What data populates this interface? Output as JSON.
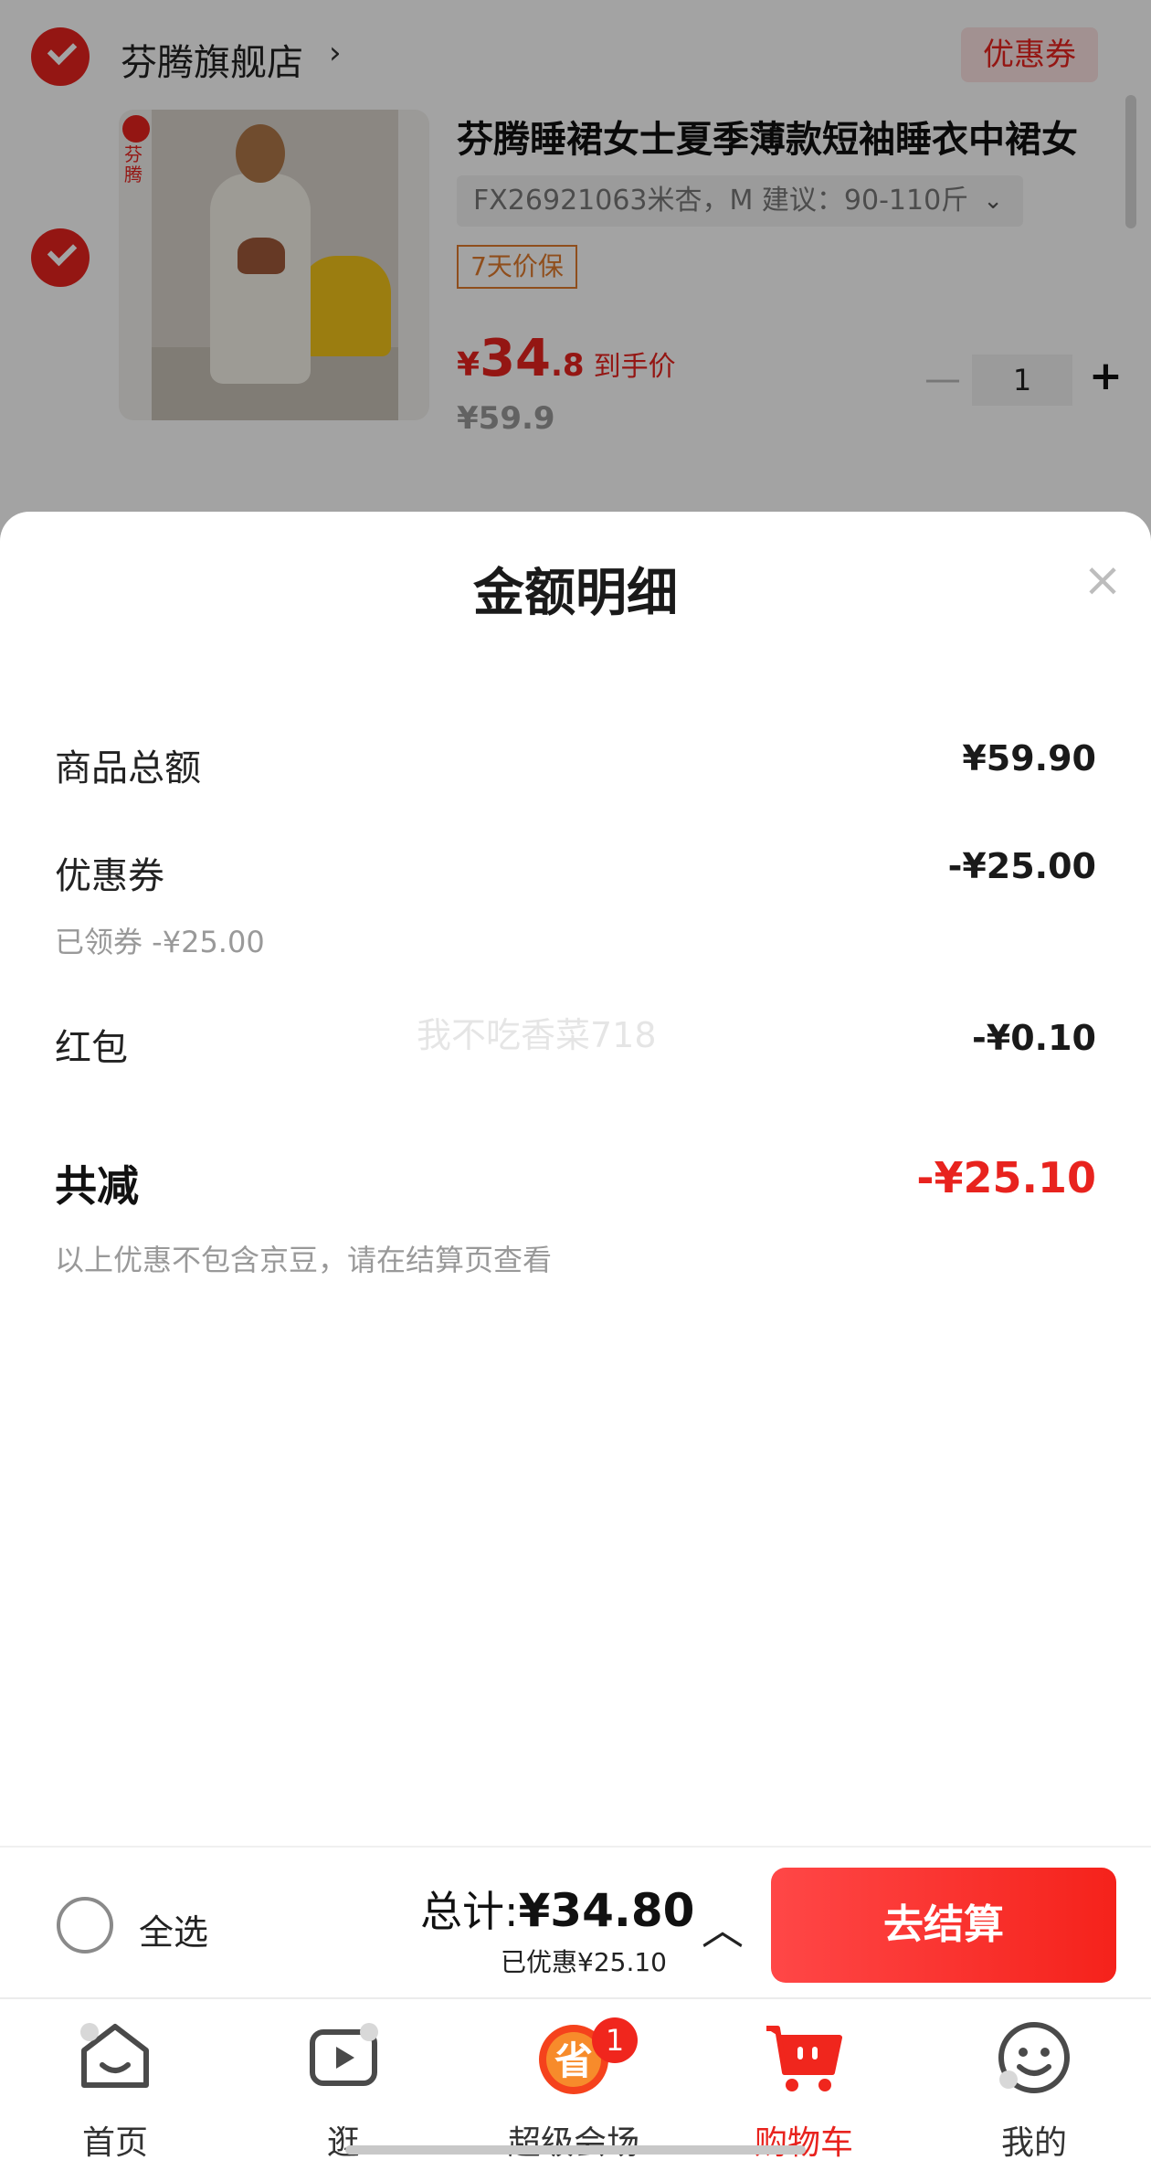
{
  "store": {
    "name": "芬腾旗舰店",
    "arrow": "›",
    "coupon_tag": "优惠券"
  },
  "product": {
    "title": "芬腾睡裙女士夏季薄款短袖睡衣中裙女",
    "sku": "FX26921063米杏，M 建议：90-110斤",
    "sku_chevron": "⌄",
    "badge": "7天价保",
    "price_yen": "¥",
    "price_int": "34",
    "price_dec": ".8",
    "price_label": "到手价",
    "original_price": "¥59.9",
    "quantity": "1",
    "minus": "—",
    "plus": "+",
    "logo_text": "芬腾"
  },
  "sheet": {
    "title": "金额明细",
    "close": "×",
    "rows": [
      {
        "label": "商品总额",
        "amount": "¥59.90"
      },
      {
        "label": "优惠券",
        "amount": "-¥25.00",
        "sub": "已领券 -¥25.00"
      },
      {
        "label": "红包",
        "amount": "-¥0.10"
      }
    ],
    "total_label": "共减",
    "total_amount": "-¥25.10",
    "note": "以上优惠不包含京豆，请在结算页查看",
    "watermark": "我不吃香菜718"
  },
  "checkout": {
    "select_all": "全选",
    "total_prefix": "总计:",
    "total_value": "¥34.80",
    "saved": "已优惠¥25.10",
    "expand": "︿",
    "button": "去结算"
  },
  "tabs": [
    {
      "label": "首页",
      "icon": "home-icon"
    },
    {
      "label": "逛",
      "icon": "video-icon"
    },
    {
      "label": "超级会场",
      "icon": "super-venue-icon",
      "badge": "1"
    },
    {
      "label": "购物车",
      "icon": "cart-icon",
      "active": true
    },
    {
      "label": "我的",
      "icon": "profile-icon"
    }
  ],
  "colors": {
    "accent": "#e8231e",
    "checkout_gradient_start": "#ff4747",
    "checkout_gradient_end": "#f5221b"
  }
}
